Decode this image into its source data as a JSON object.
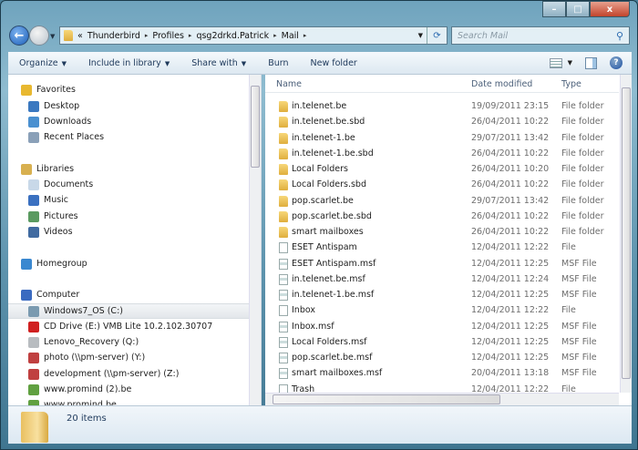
{
  "window": {
    "minimize": "–",
    "maximize": "□",
    "close": "x"
  },
  "address": {
    "overflow": "«",
    "crumbs": [
      "Thunderbird",
      "Profiles",
      "qsg2drkd.Patrick",
      "Mail"
    ],
    "separator": "▸"
  },
  "search": {
    "placeholder": "Search Mail"
  },
  "toolbar": {
    "organize": "Organize",
    "include": "Include in library",
    "share": "Share with",
    "burn": "Burn",
    "new_folder": "New folder"
  },
  "nav": {
    "items": [
      {
        "label": "Favorites",
        "icon": "star-icon",
        "color": "#e8b830",
        "indent": 0,
        "group": true
      },
      {
        "label": "Desktop",
        "icon": "desktop-icon",
        "color": "#3a78c0",
        "indent": 1
      },
      {
        "label": "Downloads",
        "icon": "downloads-icon",
        "color": "#4a90d0",
        "indent": 1
      },
      {
        "label": "Recent Places",
        "icon": "recent-places-icon",
        "color": "#8aa0b8",
        "indent": 1
      },
      {
        "label": "Libraries",
        "icon": "libraries-icon",
        "color": "#d8b050",
        "indent": 0,
        "group": true
      },
      {
        "label": "Documents",
        "icon": "documents-icon",
        "color": "#c8d8e8",
        "indent": 1
      },
      {
        "label": "Music",
        "icon": "music-icon",
        "color": "#3a70c0",
        "indent": 1
      },
      {
        "label": "Pictures",
        "icon": "pictures-icon",
        "color": "#5a9a60",
        "indent": 1
      },
      {
        "label": "Videos",
        "icon": "videos-icon",
        "color": "#406aa0",
        "indent": 1
      },
      {
        "label": "Homegroup",
        "icon": "homegroup-icon",
        "color": "#3a88d0",
        "indent": 0,
        "group": true
      },
      {
        "label": "Computer",
        "icon": "computer-icon",
        "color": "#3a6ac0",
        "indent": 0,
        "group": true
      },
      {
        "label": "Windows7_OS (C:)",
        "icon": "drive-icon",
        "color": "#7a9ab0",
        "indent": 1,
        "selected": true
      },
      {
        "label": "CD Drive (E:) VMB Lite 10.2.102.30707",
        "icon": "cd-drive-icon",
        "color": "#d02020",
        "indent": 1
      },
      {
        "label": "Lenovo_Recovery (Q:)",
        "icon": "drive-icon",
        "color": "#b8bcc0",
        "indent": 1
      },
      {
        "label": "photo (\\\\pm-server) (Y:)",
        "icon": "network-drive-disconnected-icon",
        "color": "#c04040",
        "indent": 1
      },
      {
        "label": "development (\\\\pm-server) (Z:)",
        "icon": "network-drive-disconnected-icon",
        "color": "#c04040",
        "indent": 1
      },
      {
        "label": "www.promind (2).be",
        "icon": "web-folder-icon",
        "color": "#60a040",
        "indent": 1
      },
      {
        "label": "www.promind.be",
        "icon": "web-folder-icon",
        "color": "#60a040",
        "indent": 1
      }
    ]
  },
  "columns": {
    "name": "Name",
    "date": "Date modified",
    "type": "Type"
  },
  "files": [
    {
      "name": "in.telenet.be",
      "date": "19/09/2011 23:15",
      "type": "File folder",
      "kind": "folder"
    },
    {
      "name": "in.telenet.be.sbd",
      "date": "26/04/2011 10:22",
      "type": "File folder",
      "kind": "folder"
    },
    {
      "name": "in.telenet-1.be",
      "date": "29/07/2011 13:42",
      "type": "File folder",
      "kind": "folder"
    },
    {
      "name": "in.telenet-1.be.sbd",
      "date": "26/04/2011 10:22",
      "type": "File folder",
      "kind": "folder"
    },
    {
      "name": "Local Folders",
      "date": "26/04/2011 10:20",
      "type": "File folder",
      "kind": "folder"
    },
    {
      "name": "Local Folders.sbd",
      "date": "26/04/2011 10:22",
      "type": "File folder",
      "kind": "folder"
    },
    {
      "name": "pop.scarlet.be",
      "date": "29/07/2011 13:42",
      "type": "File folder",
      "kind": "folder"
    },
    {
      "name": "pop.scarlet.be.sbd",
      "date": "26/04/2011 10:22",
      "type": "File folder",
      "kind": "folder"
    },
    {
      "name": "smart mailboxes",
      "date": "26/04/2011 10:22",
      "type": "File folder",
      "kind": "folder"
    },
    {
      "name": "ESET Antispam",
      "date": "12/04/2011 12:22",
      "type": "File",
      "kind": "file"
    },
    {
      "name": "ESET Antispam.msf",
      "date": "12/04/2011 12:25",
      "type": "MSF File",
      "kind": "msf"
    },
    {
      "name": "in.telenet.be.msf",
      "date": "12/04/2011 12:24",
      "type": "MSF File",
      "kind": "msf"
    },
    {
      "name": "in.telenet-1.be.msf",
      "date": "12/04/2011 12:25",
      "type": "MSF File",
      "kind": "msf"
    },
    {
      "name": "Inbox",
      "date": "12/04/2011 12:22",
      "type": "File",
      "kind": "file"
    },
    {
      "name": "Inbox.msf",
      "date": "12/04/2011 12:25",
      "type": "MSF File",
      "kind": "msf"
    },
    {
      "name": "Local Folders.msf",
      "date": "12/04/2011 12:25",
      "type": "MSF File",
      "kind": "msf"
    },
    {
      "name": "pop.scarlet.be.msf",
      "date": "12/04/2011 12:25",
      "type": "MSF File",
      "kind": "msf"
    },
    {
      "name": "smart mailboxes.msf",
      "date": "20/04/2011 13:18",
      "type": "MSF File",
      "kind": "msf"
    },
    {
      "name": "Trash",
      "date": "12/04/2011 12:22",
      "type": "File",
      "kind": "file"
    }
  ],
  "status": {
    "count": "20 items"
  }
}
